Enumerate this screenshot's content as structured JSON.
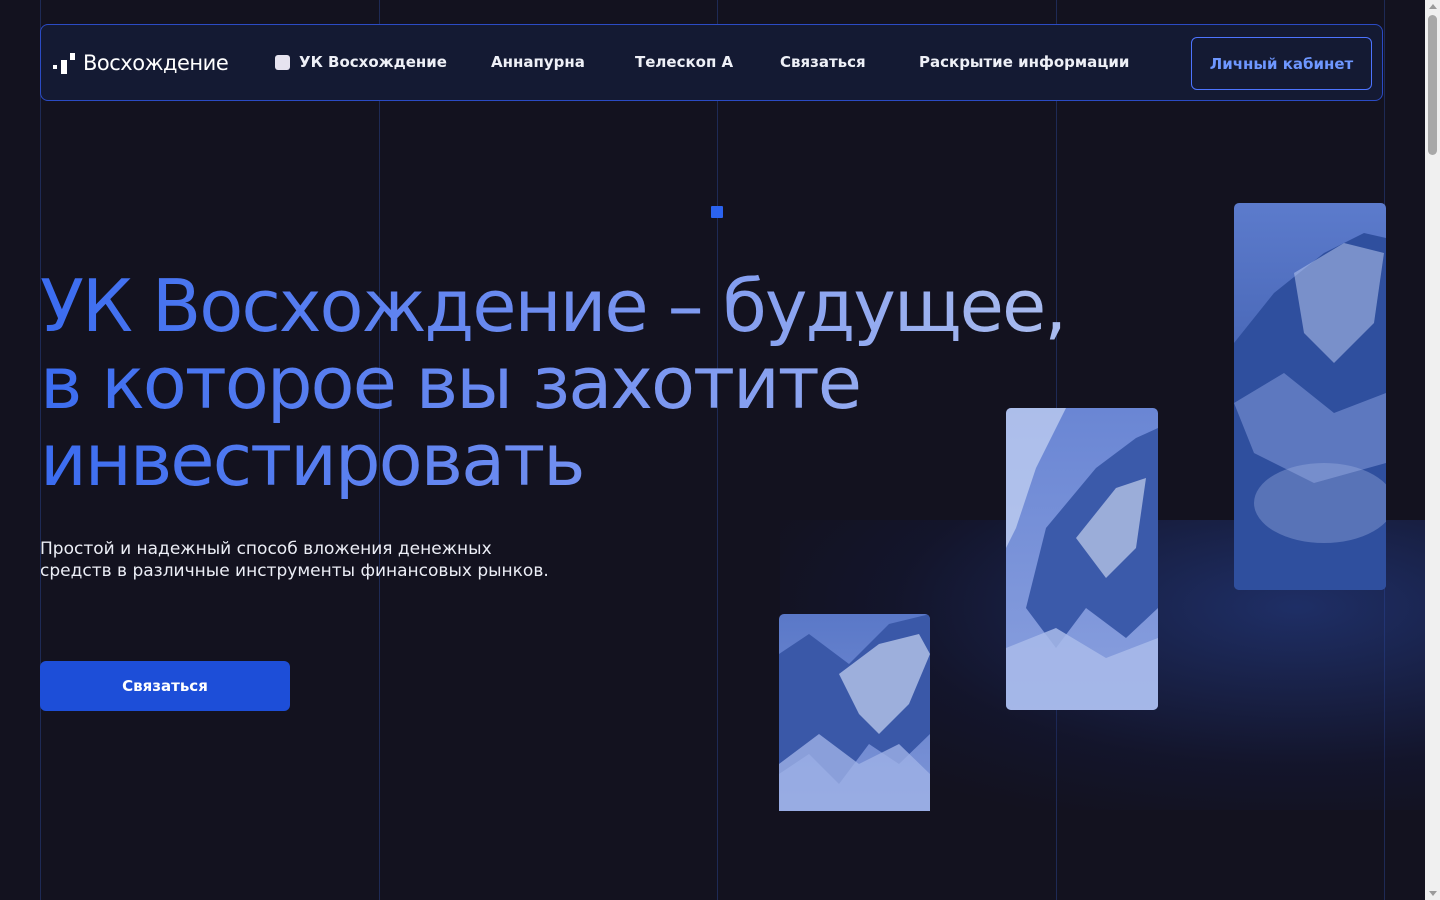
{
  "brand": {
    "logo_text": "Восхождение"
  },
  "nav": {
    "items": [
      {
        "label": "УК Восхождение",
        "active": true
      },
      {
        "label": "Аннапурна"
      },
      {
        "label": "Телескоп А"
      },
      {
        "label": "Связаться"
      },
      {
        "label": "Раскрытие информации"
      }
    ],
    "cabinet_label": "Личный кабинет"
  },
  "hero": {
    "title_lines": [
      "УК Восхождение – будущее,",
      "в которое вы захотите",
      "инвестировать"
    ],
    "subtitle_lines": [
      "Простой и надежный способ вложения денежных",
      "средств в различные инструменты финансовых рынков."
    ],
    "cta_label": "Связаться"
  },
  "images": [
    {
      "name": "mountain-photo-small",
      "description_icon": "mountain-icon"
    },
    {
      "name": "mountain-photo-medium",
      "description_icon": "mountain-icon"
    },
    {
      "name": "mountain-photo-large",
      "description_icon": "mountain-icon"
    }
  ],
  "colors": {
    "background": "#13121f",
    "accent": "#2b63f0",
    "button": "#1d4ed8",
    "border": "#2b4bc4"
  }
}
